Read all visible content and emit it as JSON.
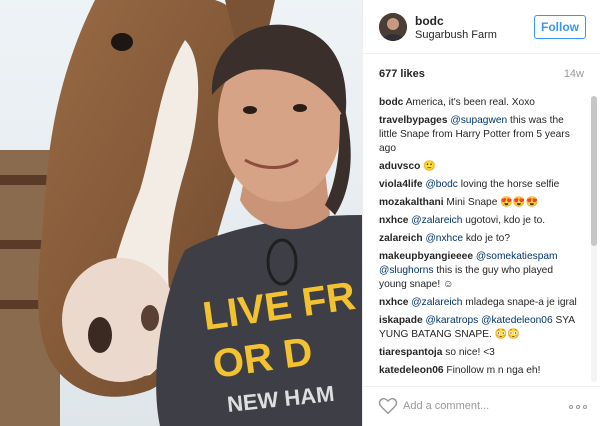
{
  "post": {
    "username": "bodc",
    "location": "Sugarbush Farm",
    "follow_label": "Follow",
    "likes": "677 likes",
    "timestamp": "14w"
  },
  "photo": {
    "shirt_text": [
      "LIVE FR",
      "OR D",
      "NEW HAM"
    ]
  },
  "comments": [
    {
      "user": "bodc",
      "parts": [
        {
          "t": "America, it's been real. Xoxo"
        }
      ]
    },
    {
      "user": "travelbypages",
      "parts": [
        {
          "t": "@supagwen",
          "m": true
        },
        {
          "t": " this was the little Snape from Harry Potter from 5 years ago"
        }
      ]
    },
    {
      "user": "aduvsco",
      "parts": [
        {
          "t": "🙂"
        }
      ]
    },
    {
      "user": "viola4life",
      "parts": [
        {
          "t": "@bodc",
          "m": true
        },
        {
          "t": " loving the horse selfie"
        }
      ]
    },
    {
      "user": "mozakalthani",
      "parts": [
        {
          "t": "Mini Snape 😍😍😍"
        }
      ]
    },
    {
      "user": "nxhce",
      "parts": [
        {
          "t": "@zalareich",
          "m": true
        },
        {
          "t": " ugotovi, kdo je to."
        }
      ]
    },
    {
      "user": "zalareich",
      "parts": [
        {
          "t": "@nxhce",
          "m": true
        },
        {
          "t": " kdo je to?"
        }
      ]
    },
    {
      "user": "makeupbyangieeee",
      "parts": [
        {
          "t": "@somekatiespam",
          "m": true
        },
        {
          "t": " "
        },
        {
          "t": "@slughorns",
          "m": true
        },
        {
          "t": " this is the guy who played young snape! ☺"
        }
      ]
    },
    {
      "user": "nxhce",
      "parts": [
        {
          "t": "@zalareich",
          "m": true
        },
        {
          "t": " mladega snape-a je igral"
        }
      ]
    },
    {
      "user": "iskapade",
      "parts": [
        {
          "t": "@karatrops",
          "m": true
        },
        {
          "t": " "
        },
        {
          "t": "@katedeleon06",
          "m": true
        },
        {
          "t": " SYA YUNG BATANG SNAPE. 😳😳"
        }
      ]
    },
    {
      "user": "tiarespantoja",
      "parts": [
        {
          "t": "so nice! <3"
        }
      ]
    },
    {
      "user": "katedeleon06",
      "parts": [
        {
          "t": "Finollow m n nga eh!"
        }
      ]
    }
  ],
  "footer": {
    "comment_placeholder": "Add a comment..."
  },
  "icons": {
    "like": "heart-outline-icon",
    "more": "ellipsis-icon"
  },
  "colors": {
    "accent": "#3897f0",
    "mention": "#003569",
    "muted": "#999999"
  }
}
